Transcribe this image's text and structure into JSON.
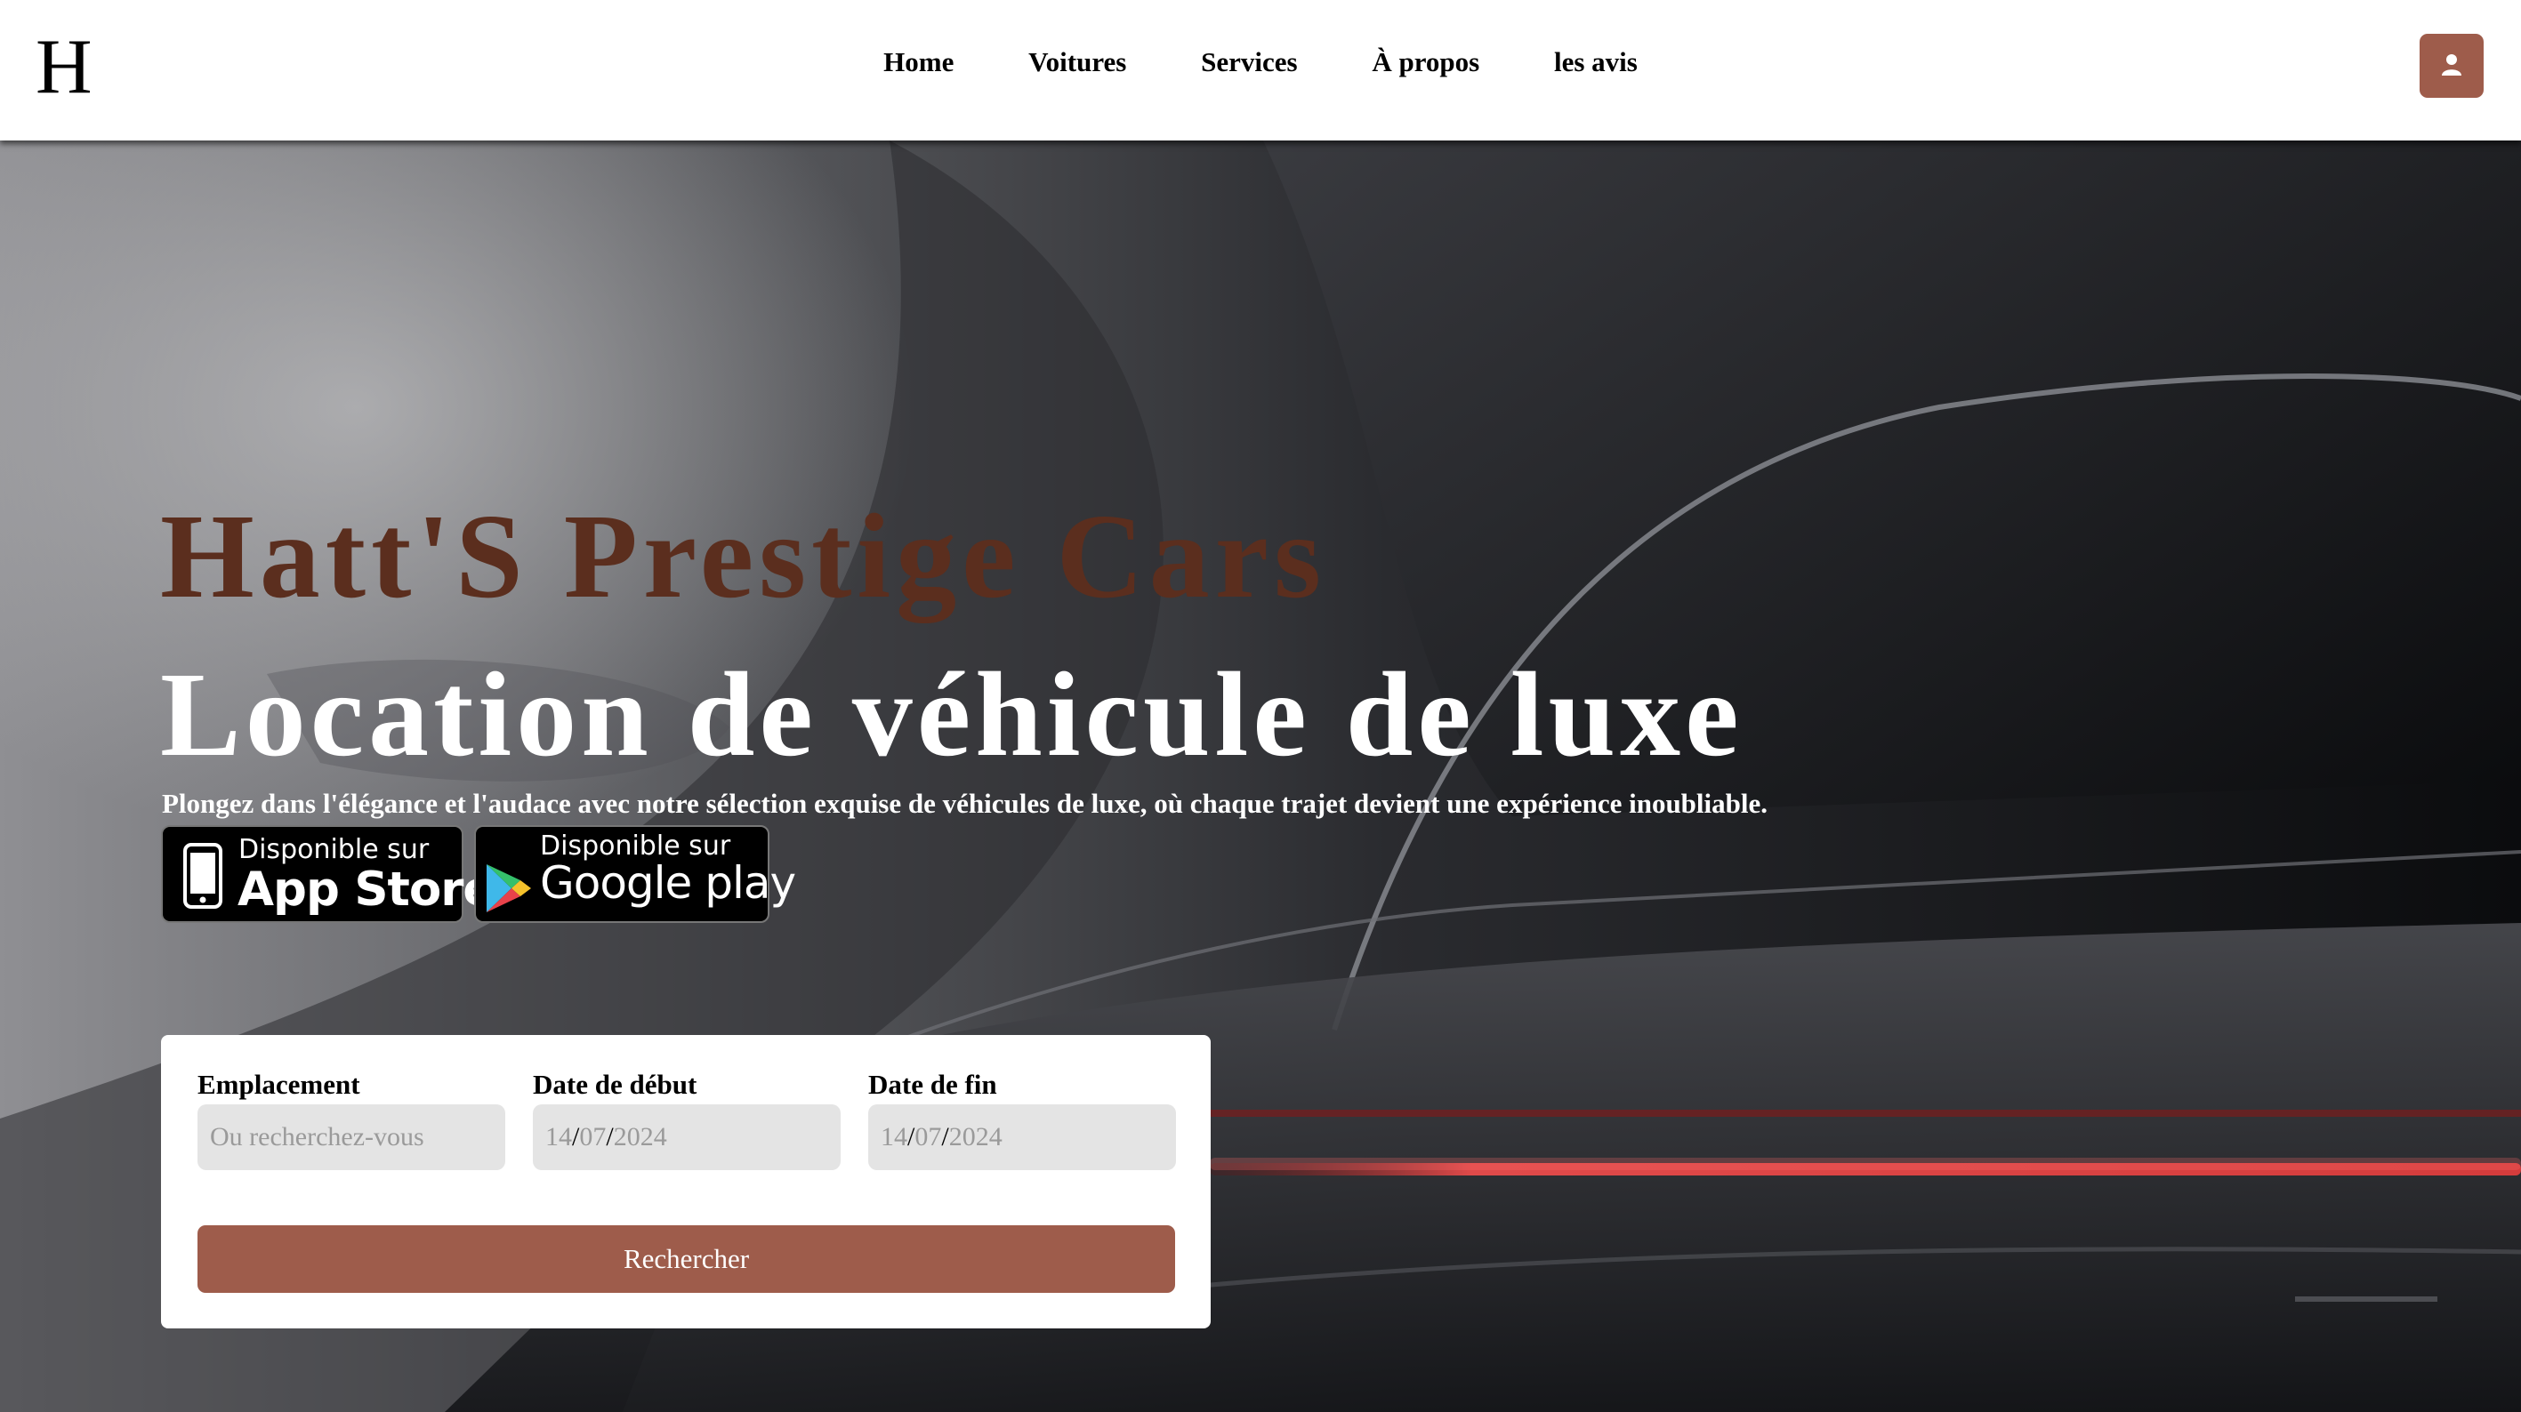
{
  "header": {
    "logo": "H",
    "nav": [
      "Home",
      "Voitures",
      "Services",
      "À propos",
      "les avis"
    ],
    "user_icon": "user-icon",
    "accent_color": "#9e5c4b"
  },
  "hero": {
    "brand": "Hatt'S Prestige Cars",
    "headline": "Location de véhicule de luxe",
    "tagline": "Plongez dans l'élégance et l'audace avec notre sélection exquise de véhicules de luxe, où chaque trajet devient une expérience inoubliable.",
    "brand_color": "#5b2e1e"
  },
  "stores": {
    "apple": {
      "small": "Disponible sur",
      "big": "App Store",
      "icon": "iphone-icon"
    },
    "google": {
      "small": "Disponible sur",
      "big": "Google play",
      "icon": "google-play-icon"
    }
  },
  "search": {
    "location": {
      "label": "Emplacement",
      "placeholder": "Ou recherchez-vous"
    },
    "start": {
      "label": "Date de début",
      "day": "14",
      "month": "07",
      "year": "2024"
    },
    "end": {
      "label": "Date de fin",
      "day": "14",
      "month": "07",
      "year": "2024"
    },
    "submit": "Rechercher"
  }
}
